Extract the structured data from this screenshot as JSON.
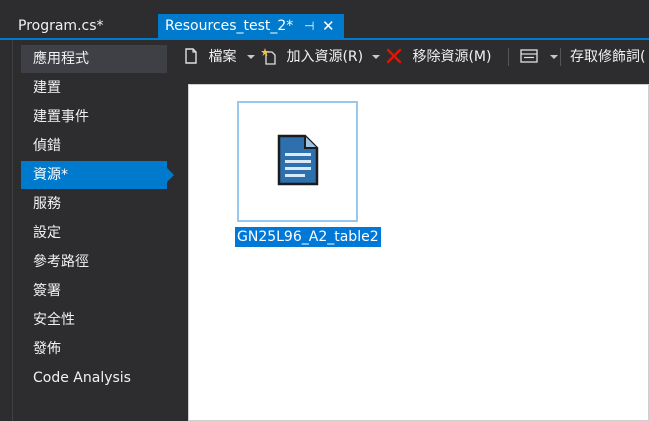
{
  "tabs": {
    "program": "Program.cs*",
    "active": "Resources_test_2*"
  },
  "nav": {
    "items": [
      "應用程式",
      "建置",
      "建置事件",
      "偵錯",
      "資源*",
      "服務",
      "設定",
      "參考路徑",
      "簽署",
      "安全性",
      "發佈",
      "Code Analysis"
    ],
    "selected_index": 4
  },
  "toolbar": {
    "files_label": "檔案",
    "add_resource_label": "加入資源(R)",
    "remove_resource_label": "移除資源(M)",
    "access_modifier_label": "存取修飾詞("
  },
  "resources": {
    "items": [
      {
        "name": "GN25L96_A2_table2",
        "icon": "text-file-icon"
      }
    ]
  },
  "colors": {
    "accent": "#007acc",
    "background": "#2d2d30",
    "selection": "#0078d7",
    "remove_icon": "#e51400"
  }
}
